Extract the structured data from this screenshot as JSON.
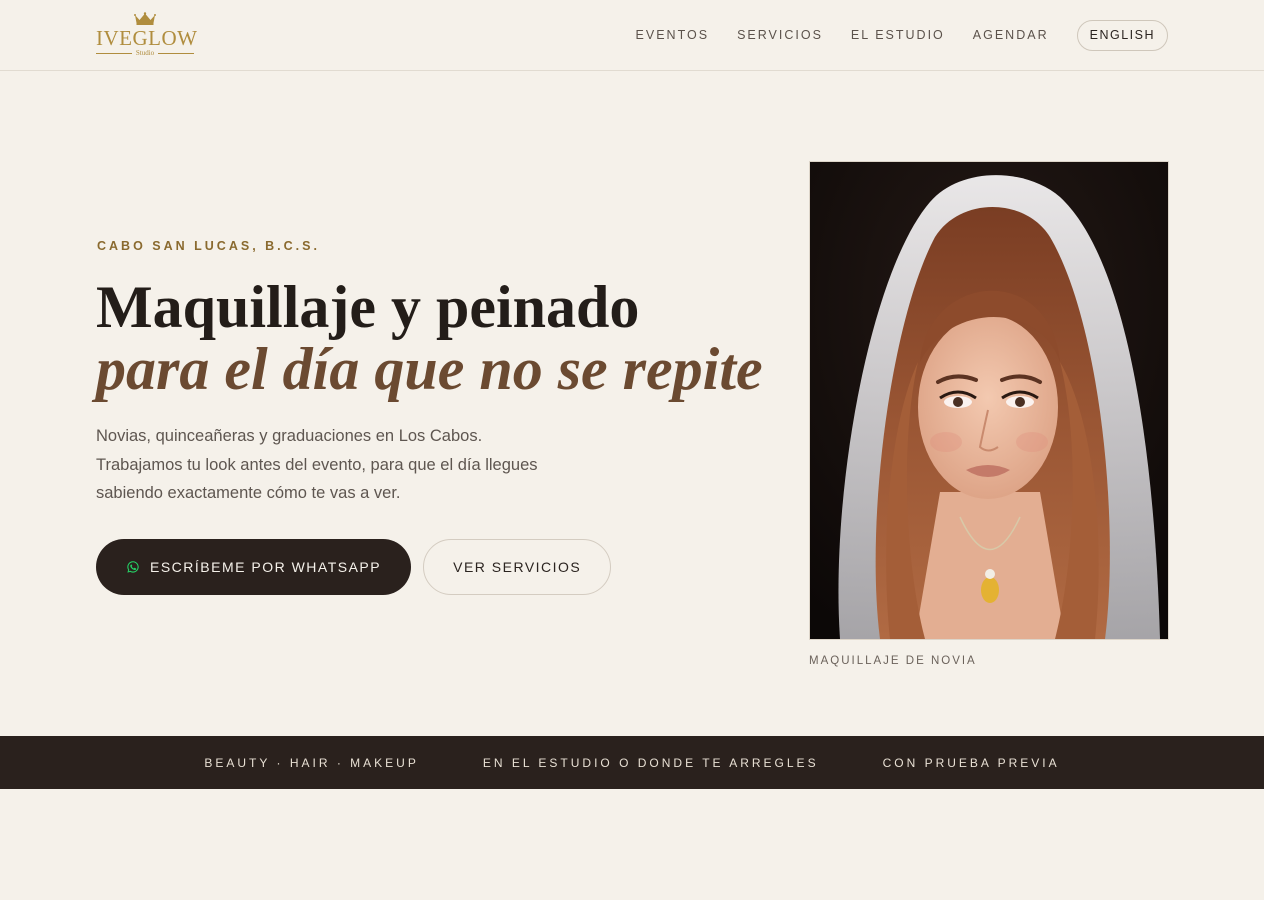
{
  "header": {
    "logo_text": "IVEGLOW",
    "logo_sub": "Studio",
    "nav": [
      "EVENTOS",
      "SERVICIOS",
      "EL ESTUDIO",
      "AGENDAR"
    ],
    "lang_button": "ENGLISH"
  },
  "hero": {
    "eyebrow": "CABO SAN LUCAS, B.C.S.",
    "headline_line1": "Maquillaje y peinado",
    "headline_line2": "para el día que no se repite",
    "lead": "Novias, quinceañeras y graduaciones en Los Cabos. Trabajamos tu look antes del evento, para que el día llegues sabiendo exactamente cómo te vas a ver.",
    "primary_button": "ESCRÍBEME POR WHATSAPP",
    "secondary_button": "VER SERVICIOS",
    "image_caption": "MAQUILLAJE DE NOVIA"
  },
  "strip": {
    "items": [
      "BEAUTY · HAIR · MAKEUP",
      "EN EL ESTUDIO O DONDE TE ARREGLES",
      "CON PRUEBA PREVIA"
    ]
  },
  "colors": {
    "background": "#f5f1ea",
    "accent_gold": "#b08d3e",
    "dark": "#2a211d",
    "headline_italic": "#6b4a31",
    "whatsapp_green": "#25d366"
  },
  "icons": {
    "logo": "crown-icon",
    "primary_button": "whatsapp-icon"
  }
}
